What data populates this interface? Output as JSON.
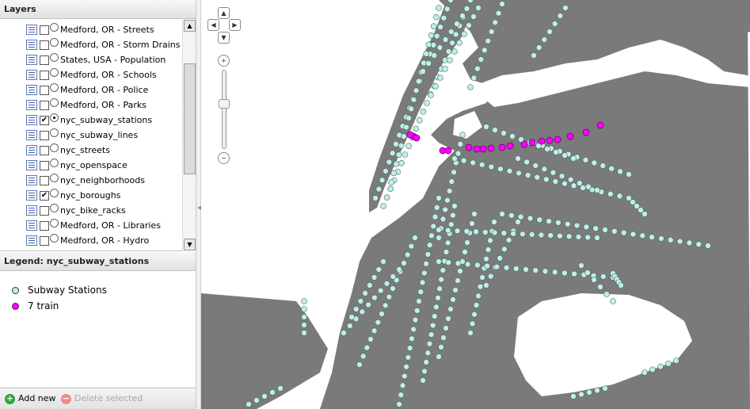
{
  "layers_panel": {
    "title": "Layers",
    "items": [
      {
        "label": "Medford, OR - Streets",
        "checked": false,
        "radio": false
      },
      {
        "label": "Medford, OR - Storm Drains",
        "checked": false,
        "radio": false
      },
      {
        "label": "States, USA - Population",
        "checked": false,
        "radio": false
      },
      {
        "label": "Medford, OR - Schools",
        "checked": false,
        "radio": false
      },
      {
        "label": "Medford, OR - Police",
        "checked": false,
        "radio": false
      },
      {
        "label": "Medford, OR - Parks",
        "checked": false,
        "radio": false
      },
      {
        "label": "nyc_subway_stations",
        "checked": true,
        "radio": true
      },
      {
        "label": "nyc_subway_lines",
        "checked": false,
        "radio": false
      },
      {
        "label": "nyc_streets",
        "checked": false,
        "radio": false
      },
      {
        "label": "nyc_openspace",
        "checked": false,
        "radio": false
      },
      {
        "label": "nyc_neighborhoods",
        "checked": false,
        "radio": false
      },
      {
        "label": "nyc_boroughs",
        "checked": true,
        "radio": false
      },
      {
        "label": "nyc_bike_racks",
        "checked": false,
        "radio": false
      },
      {
        "label": "Medford, OR - Libraries",
        "checked": false,
        "radio": false
      },
      {
        "label": "Medford, OR - Hydro",
        "checked": false,
        "radio": false
      }
    ],
    "check_glyph": "✔"
  },
  "legend_panel": {
    "title": "Legend: nyc_subway_stations",
    "items": [
      {
        "label": "Subway Stations",
        "color": "#bfefe6"
      },
      {
        "label": "7 train",
        "color": "#ff00ff"
      }
    ]
  },
  "toolbar": {
    "add_label": "Add new",
    "delete_label": "Delete selected",
    "add_color": "#2ea43a",
    "delete_color": "#f08a8a"
  },
  "map": {
    "land_color": "#7a7a7a",
    "water_color": "#ffffff",
    "station_color": "#bfefe6",
    "train7_color": "#ff00ff",
    "nav": {
      "up": "▲",
      "down": "▼",
      "left": "◀",
      "right": "▶",
      "zoom_in": "+",
      "zoom_out": "−"
    }
  }
}
